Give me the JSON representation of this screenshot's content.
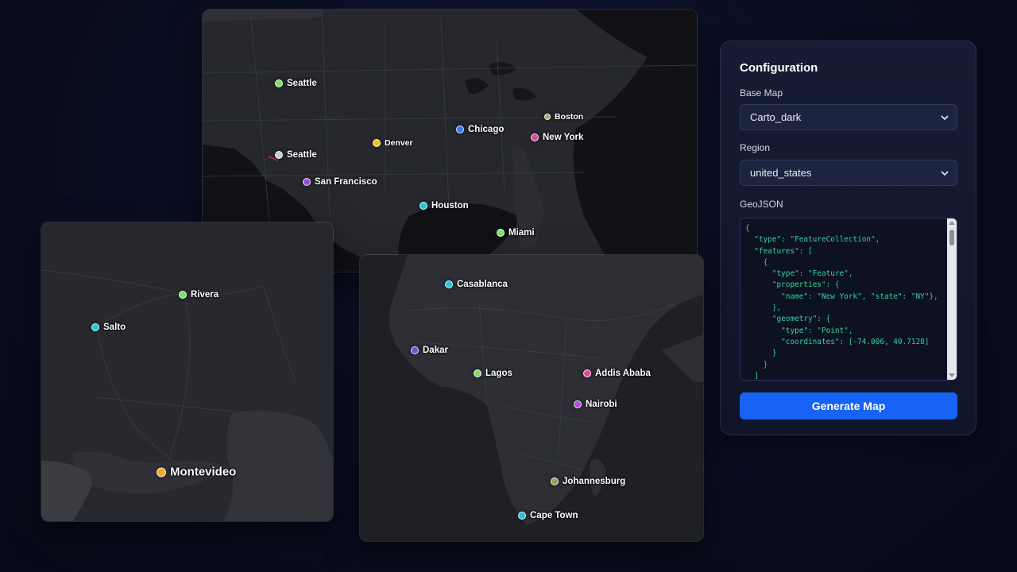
{
  "maps": {
    "us": {
      "markers": [
        {
          "name": "Seattle",
          "color": "#7ddf64"
        },
        {
          "name": "Seattle",
          "color": "#c9c9d6"
        },
        {
          "name": "San Francisco",
          "color": "#9b4be0"
        },
        {
          "name": "Denver",
          "color": "#f1c40f"
        },
        {
          "name": "Chicago",
          "color": "#2f7cf6"
        },
        {
          "name": "Boston",
          "color": "#b8a46a"
        },
        {
          "name": "New York",
          "color": "#e0479e"
        },
        {
          "name": "Houston",
          "color": "#22c7d8"
        },
        {
          "name": "Miami",
          "color": "#7ddf64"
        }
      ]
    },
    "uruguay": {
      "markers": [
        {
          "name": "Rivera",
          "color": "#7ddf64"
        },
        {
          "name": "Salto",
          "color": "#22c7d8"
        },
        {
          "name": "Montevideo",
          "color": "#f5a623"
        }
      ]
    },
    "africa": {
      "markers": [
        {
          "name": "Casablanca",
          "color": "#22c7d8"
        },
        {
          "name": "Dakar",
          "color": "#7b4be0"
        },
        {
          "name": "Lagos",
          "color": "#7ddf64"
        },
        {
          "name": "Addis Ababa",
          "color": "#e0479e"
        },
        {
          "name": "Nairobi",
          "color": "#b04be0"
        },
        {
          "name": "Johannesburg",
          "color": "#9aa05a"
        },
        {
          "name": "Cape Town",
          "color": "#22c7d8"
        }
      ]
    }
  },
  "config": {
    "title": "Configuration",
    "base_map_label": "Base Map",
    "base_map_value": "Carto_dark",
    "region_label": "Region",
    "region_value": "united_states",
    "geojson_label": "GeoJSON",
    "geojson_lines": [
      "{",
      "  \"type\": \"FeatureCollection\",",
      "  \"features\": [",
      "    {",
      "      \"type\": \"Feature\",",
      "      \"properties\": {",
      "        \"name\": \"New York\", \"state\": \"NY\"},",
      "      },",
      "      \"geometry\": {",
      "        \"type\": \"Point\",",
      "        \"coordinates\": [-74.006, 40.7128]",
      "      }",
      "    }",
      "  ]"
    ],
    "generate_button": "Generate Map"
  },
  "colors": {
    "accent": "#1763f5",
    "code_text": "#34d399",
    "map_land": "#2b2d33",
    "map_water": "#101114"
  }
}
